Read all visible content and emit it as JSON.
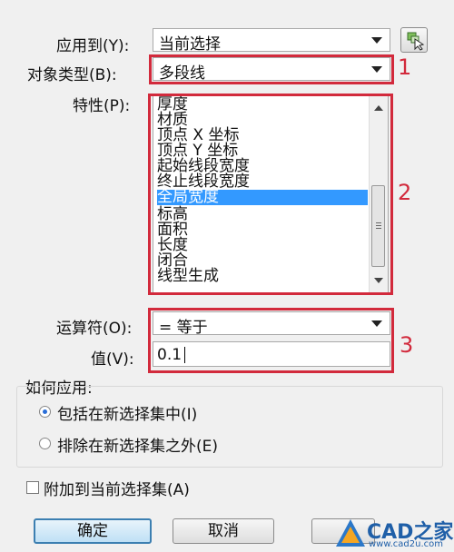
{
  "apply_to": {
    "label": "应用到(Y):",
    "value": "当前选择"
  },
  "object_type": {
    "label": "对象类型(B):",
    "value": "多段线"
  },
  "properties": {
    "label": "特性(P):",
    "items": [
      "厚度",
      "材质",
      "顶点 X 坐标",
      "顶点 Y 坐标",
      "起始线段宽度",
      "终止线段宽度",
      "全局宽度",
      "标高",
      "面积",
      "长度",
      "闭合",
      "线型生成"
    ],
    "selected": "全局宽度"
  },
  "operator": {
    "label": "运算符(O):",
    "value": "= 等于"
  },
  "value_field": {
    "label": "值(V):",
    "value": "0.1"
  },
  "how_to_apply": {
    "title": "如何应用:",
    "options": [
      {
        "label": "包括在新选择集中(I)",
        "checked": true
      },
      {
        "label": "排除在新选择集之外(E)",
        "checked": false
      }
    ]
  },
  "append_checkbox": {
    "label": "附加到当前选择集(A)",
    "checked": false
  },
  "buttons": {
    "ok": "确定",
    "cancel": "取消"
  },
  "annotations": [
    "1",
    "2",
    "3"
  ],
  "watermark": {
    "brand": "CAD之家",
    "url": "www.cad2u.com"
  },
  "colors": {
    "annotation_red": "#d22a3c",
    "selection_blue": "#3399ff"
  }
}
